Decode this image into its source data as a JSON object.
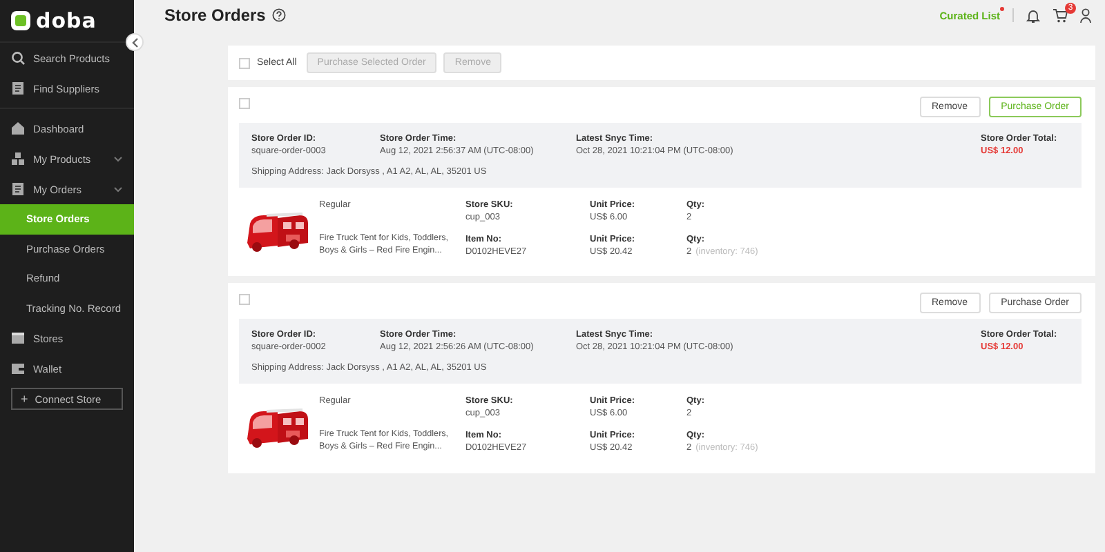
{
  "sidebar": {
    "logo": "doba",
    "items": [
      {
        "label": "Search Products",
        "kind": "item",
        "selected": false
      },
      {
        "label": "Find Suppliers",
        "kind": "item",
        "selected": false
      },
      {
        "label": "Dashboard",
        "kind": "item",
        "selected": false
      },
      {
        "label": "My Products",
        "kind": "group",
        "selected": false
      },
      {
        "label": "My Orders",
        "kind": "group",
        "selected": false
      },
      {
        "label": "Store Orders",
        "kind": "subitem",
        "selected": true
      },
      {
        "label": "Purchase Orders",
        "kind": "subitem",
        "selected": false
      },
      {
        "label": "Refund",
        "kind": "subitem",
        "selected": false
      },
      {
        "label": "Tracking No. Record",
        "kind": "subitem",
        "selected": false
      },
      {
        "label": "Stores",
        "kind": "item",
        "selected": false
      },
      {
        "label": "Wallet",
        "kind": "item",
        "selected": false
      }
    ],
    "connect_button": {
      "icon": "+",
      "label": "Connect Store"
    }
  },
  "header": {
    "title": "Store Orders",
    "curated_list": "Curated List",
    "cart_count": "3"
  },
  "toolbar": {
    "select_all": {
      "label": "Select All",
      "checked": false
    },
    "buttons": [
      {
        "label": "Purchase Selected Order",
        "disabled": true
      },
      {
        "label": "Remove",
        "disabled": true
      }
    ]
  },
  "orders": [
    {
      "checked": false,
      "buttons": [
        {
          "label": "Remove",
          "highlighted": false
        },
        {
          "label": "Purchase Order",
          "highlighted": true
        }
      ],
      "fields": [
        {
          "label": "Store Order ID:",
          "value": "square-order-0003"
        },
        {
          "label": "Store Order Time:",
          "value": "Aug 12, 2021 2:56:37 AM (UTC-08:00)"
        },
        {
          "label": "Latest Snyc Time:",
          "value": "Oct 28, 2021 10:21:04 PM (UTC-08:00)"
        }
      ],
      "total": {
        "label": "Store Order Total:",
        "value": "US$ 12.00"
      },
      "shipping_address": "Shipping Address: Jack Dorsyss , A1 A2, AL, AL, 35201 US",
      "product": {
        "variant": "Regular",
        "title": "Fire Truck Tent for Kids, Toddlers, Boys & Girls – Red Fire Engin...",
        "rows": [
          [
            {
              "label": "Store SKU:",
              "value": "cup_003"
            },
            {
              "label": "Unit Price:",
              "value": "US$ 6.00"
            },
            {
              "label": "Qty:",
              "value": "2"
            }
          ],
          [
            {
              "label": "Item No:",
              "value": "D0102HEVE27"
            },
            {
              "label": "Unit Price:",
              "value": "US$ 20.42"
            },
            {
              "label": "Qty:",
              "value": "2",
              "note": "(inventory: 746)"
            }
          ]
        ]
      }
    },
    {
      "checked": false,
      "buttons": [
        {
          "label": "Remove",
          "highlighted": false
        },
        {
          "label": "Purchase Order",
          "highlighted": false
        }
      ],
      "fields": [
        {
          "label": "Store Order ID:",
          "value": "square-order-0002"
        },
        {
          "label": "Store Order Time:",
          "value": "Aug 12, 2021 2:56:26 AM (UTC-08:00)"
        },
        {
          "label": "Latest Snyc Time:",
          "value": "Oct 28, 2021 10:21:04 PM (UTC-08:00)"
        }
      ],
      "total": {
        "label": "Store Order Total:",
        "value": "US$ 12.00"
      },
      "shipping_address": "Shipping Address: Jack Dorsyss , A1 A2, AL, AL, 35201 US",
      "product": {
        "variant": "Regular",
        "title": "Fire Truck Tent for Kids, Toddlers, Boys & Girls – Red Fire Engin...",
        "rows": [
          [
            {
              "label": "Store SKU:",
              "value": "cup_003"
            },
            {
              "label": "Unit Price:",
              "value": "US$ 6.00"
            },
            {
              "label": "Qty:",
              "value": "2"
            }
          ],
          [
            {
              "label": "Item No:",
              "value": "D0102HEVE27"
            },
            {
              "label": "Unit Price:",
              "value": "US$ 20.42"
            },
            {
              "label": "Qty:",
              "value": "2",
              "note": "(inventory: 746)"
            }
          ]
        ]
      }
    }
  ]
}
